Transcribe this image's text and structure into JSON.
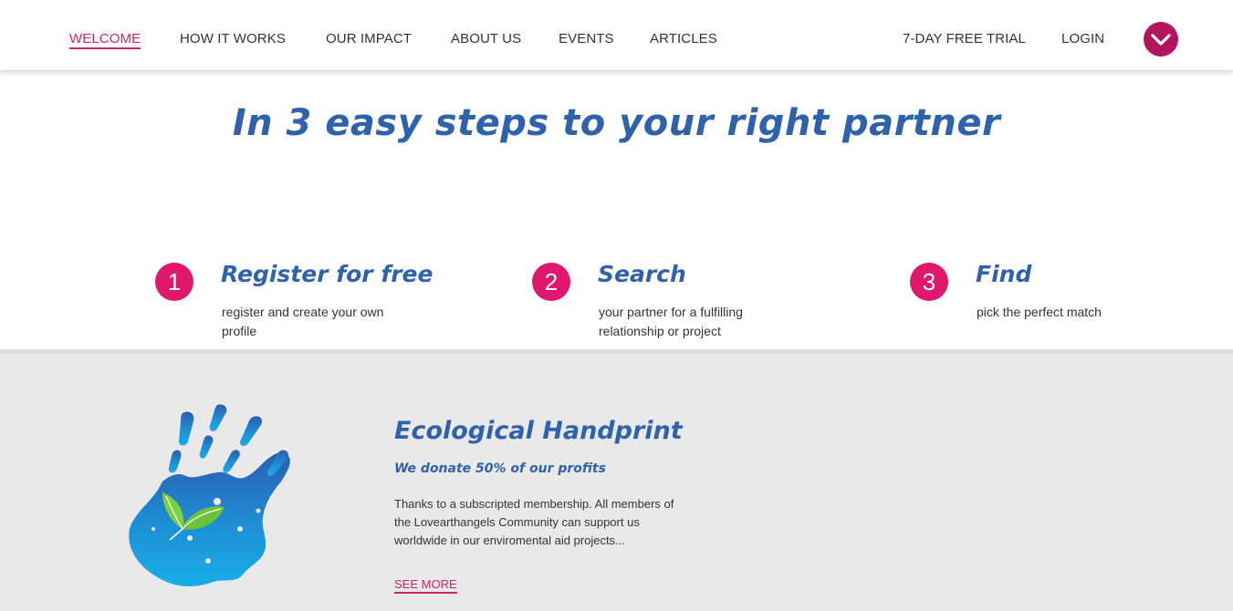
{
  "nav": {
    "left_items": [
      "WELCOME",
      "HOW IT WORKS",
      "OUR IMPACT",
      "ABOUT US",
      "EVENTS",
      "ARTICLES"
    ],
    "active_item": "WELCOME",
    "trial_label": "7-DAY FREE TRIAL",
    "login_label": "LOGIN",
    "menu_icon": "chevron-down-icon"
  },
  "hero": {
    "headline": "In 3 easy steps to your right partner"
  },
  "steps": [
    {
      "number": "1",
      "title": "Register for free",
      "description": "register and create your own profile"
    },
    {
      "number": "2",
      "title": "Search",
      "description": "your partner for a fulfilling relationship or project"
    },
    {
      "number": "3",
      "title": "Find",
      "description": "pick the perfect match"
    }
  ],
  "eco": {
    "image": "blue-handprint-with-leaves",
    "title": "Ecological Handprint",
    "subtitle": "We donate 50% of our profits",
    "text": "Thanks to a subscripted membership. All members of the Lovearthangels Community can support us worldwide in our enviromental aid projects...",
    "link_label": "SEE MORE"
  },
  "colors": {
    "accent_pink": "#e0176d",
    "brand_blue": "#2f62ad",
    "menu_button": "#b5145e"
  }
}
